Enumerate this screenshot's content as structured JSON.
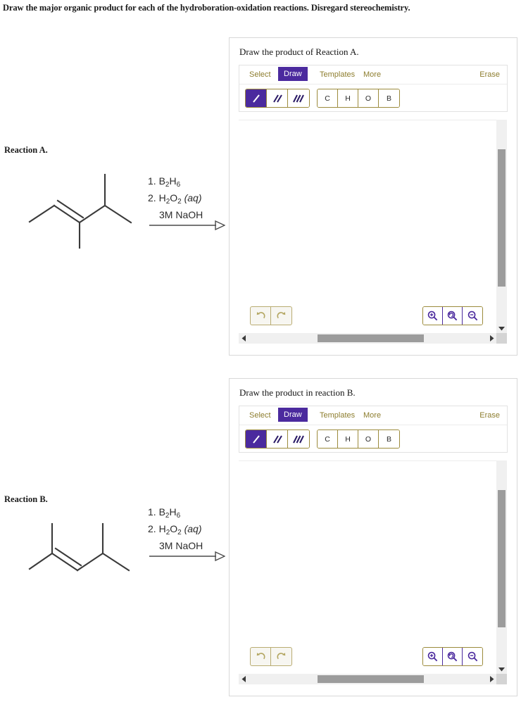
{
  "page": {
    "prompt": "Draw the major organic product for each of the hydroboration-oxidation reactions. Disregard stereochemistry."
  },
  "colors": {
    "accent_purple": "#4b2a9e",
    "gold": "#8d7d2e",
    "border_gold": "#9c8b3c",
    "panel_border": "#d8d8d8",
    "scroll_thumb": "#9c9c9c",
    "structure_line": "#3a3a3a"
  },
  "reactions": [
    {
      "label": "Reaction A.",
      "reagents": {
        "line1_num": "1.",
        "line1_formula_pre": "B",
        "line1_sub1": "2",
        "line1_mid": "H",
        "line1_sub2": "6",
        "line2_num": "2.",
        "line2_h": "H",
        "line2_sub1": "2",
        "line2_o": "O",
        "line2_sub2": "2",
        "line2_state": "(aq)",
        "line3": "3M NaOH"
      },
      "structure_name": "3,4-dimethyl-2-pentene"
    },
    {
      "label": "Reaction B.",
      "reagents": {
        "line1_num": "1.",
        "line1_formula_pre": "B",
        "line1_sub1": "2",
        "line1_mid": "H",
        "line1_sub2": "6",
        "line2_num": "2.",
        "line2_h": "H",
        "line2_sub1": "2",
        "line2_o": "O",
        "line2_sub2": "2",
        "line2_state": "(aq)",
        "line3": "3M NaOH"
      },
      "structure_name": "2,4-dimethyl-2-pentene"
    }
  ],
  "editors": [
    {
      "title": "Draw the product of Reaction A.",
      "menu": {
        "select": "Select",
        "draw": "Draw",
        "templates": "Templates",
        "more": "More",
        "erase": "Erase",
        "active": "Draw"
      },
      "bond_tools": [
        {
          "name": "single-bond-tool",
          "glyph": "/",
          "selected": true
        },
        {
          "name": "double-bond-tool",
          "glyph": "//",
          "selected": false
        },
        {
          "name": "triple-bond-tool",
          "glyph": "///",
          "selected": false
        }
      ],
      "atom_tools": [
        {
          "label": "C"
        },
        {
          "label": "H"
        },
        {
          "label": "O"
        },
        {
          "label": "B"
        }
      ],
      "history_tools": [
        {
          "name": "undo-button",
          "glyph": "↺"
        },
        {
          "name": "redo-button",
          "glyph": "↻"
        }
      ],
      "zoom_tools": [
        {
          "name": "zoom-in-button"
        },
        {
          "name": "zoom-reset-button"
        },
        {
          "name": "zoom-out-button"
        }
      ]
    },
    {
      "title": "Draw the product in reaction B.",
      "menu": {
        "select": "Select",
        "draw": "Draw",
        "templates": "Templates",
        "more": "More",
        "erase": "Erase",
        "active": "Draw"
      },
      "bond_tools": [
        {
          "name": "single-bond-tool",
          "glyph": "/",
          "selected": true
        },
        {
          "name": "double-bond-tool",
          "glyph": "//",
          "selected": false
        },
        {
          "name": "triple-bond-tool",
          "glyph": "///",
          "selected": false
        }
      ],
      "atom_tools": [
        {
          "label": "C"
        },
        {
          "label": "H"
        },
        {
          "label": "O"
        },
        {
          "label": "B"
        }
      ],
      "history_tools": [
        {
          "name": "undo-button",
          "glyph": "↺"
        },
        {
          "name": "redo-button",
          "glyph": "↻"
        }
      ],
      "zoom_tools": [
        {
          "name": "zoom-in-button"
        },
        {
          "name": "zoom-reset-button"
        },
        {
          "name": "zoom-out-button"
        }
      ]
    }
  ]
}
